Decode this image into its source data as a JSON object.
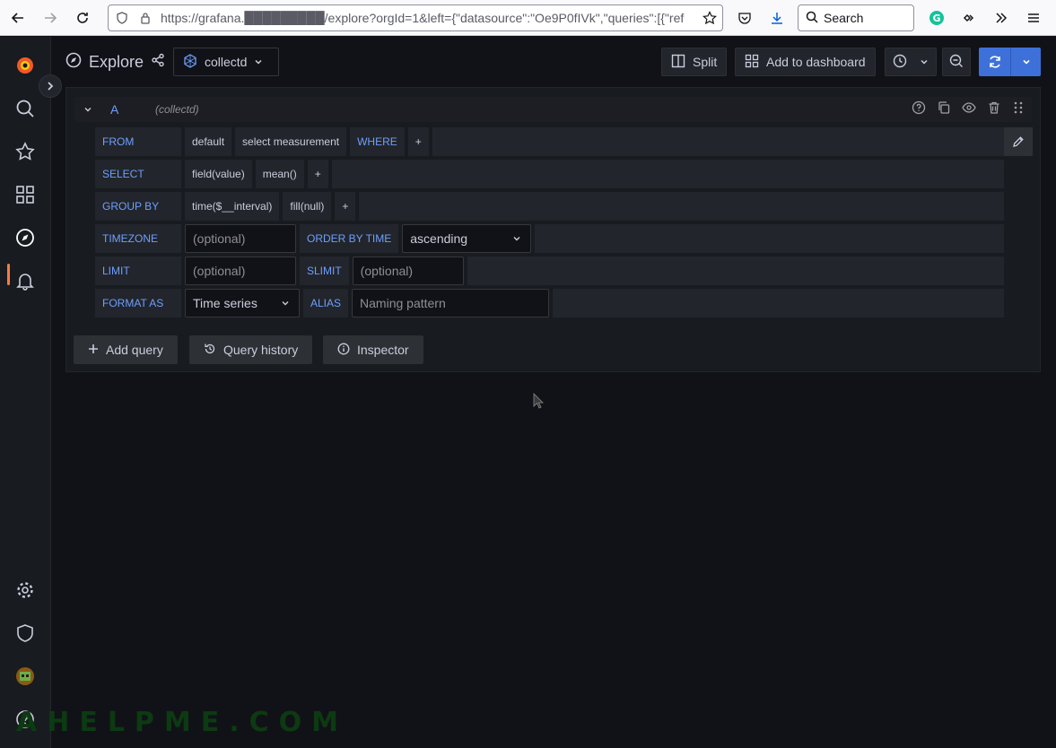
{
  "browser": {
    "url": "https://grafana.█████████/explore?orgId=1&left={\"datasource\":\"Oe9P0fIVk\",\"queries\":[{\"ref",
    "search_placeholder": "Search"
  },
  "explore": {
    "title": "Explore",
    "datasource": "collectd",
    "split_label": "Split",
    "add_to_dashboard_label": "Add to dashboard"
  },
  "query": {
    "letter": "A",
    "datasource_hint": "(collectd)",
    "from": {
      "keyword": "FROM",
      "policy": "default",
      "measurement": "select measurement",
      "where_keyword": "WHERE",
      "plus": "+"
    },
    "select": {
      "keyword": "SELECT",
      "field": "field(value)",
      "agg": "mean()",
      "plus": "+"
    },
    "group_by": {
      "keyword": "GROUP BY",
      "time": "time($__interval)",
      "fill": "fill(null)",
      "plus": "+"
    },
    "timezone": {
      "keyword": "TIMEZONE",
      "placeholder": "(optional)",
      "order_keyword": "ORDER BY TIME",
      "order_value": "ascending"
    },
    "limit": {
      "keyword": "LIMIT",
      "placeholder": "(optional)",
      "slimit_keyword": "SLIMIT",
      "slimit_placeholder": "(optional)"
    },
    "format": {
      "keyword": "FORMAT AS",
      "value": "Time series",
      "alias_keyword": "ALIAS",
      "alias_placeholder": "Naming pattern"
    }
  },
  "actions": {
    "add_query": "Add query",
    "query_history": "Query history",
    "inspector": "Inspector"
  },
  "watermark": "AHELPME.COM",
  "colors": {
    "accent_blue": "#3d71d9",
    "keyword_blue": "#6e9fff",
    "grafana_orange": "#ff7941"
  }
}
